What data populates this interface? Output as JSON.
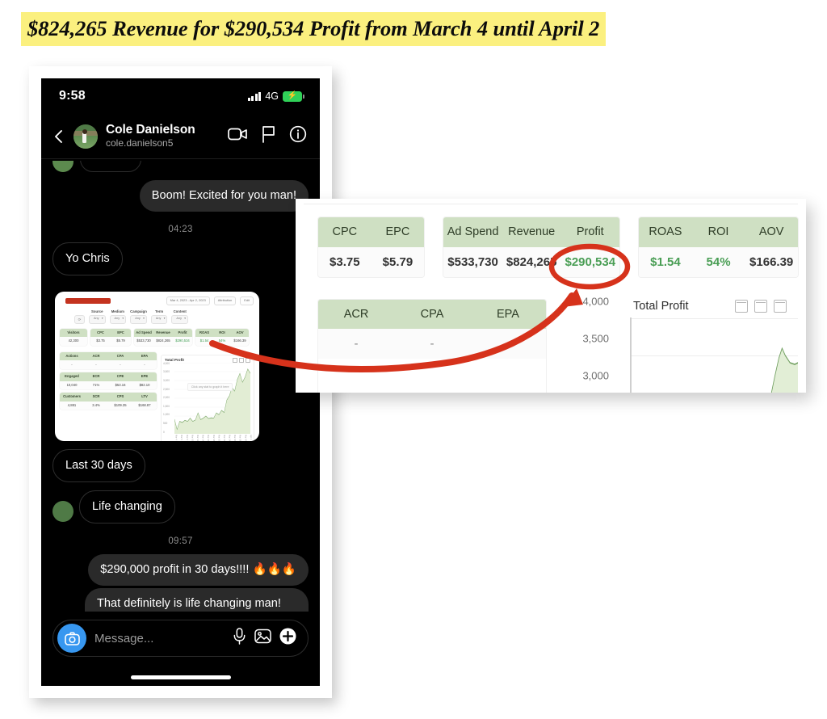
{
  "headline": "$824,265 Revenue for $290,534 Profit from March 4 until April 2",
  "colors": {
    "highlight": "#fbf07f",
    "annotation_red": "#d6321b",
    "table_header_green": "#cfe0c3",
    "positive_green": "#4a9e55",
    "messenger_blue": "#3797f0"
  },
  "phone": {
    "status_bar": {
      "time": "9:58",
      "network": "4G",
      "signal_icon": "signal-bars-icon",
      "battery_icon": "battery-charging-icon"
    },
    "chat_header": {
      "back_icon": "back-chevron-icon",
      "avatar_icon": "user-avatar",
      "name": "Cole Danielson",
      "handle": "cole.danielson5",
      "video_icon": "video-call-icon",
      "flag_icon": "flag-icon",
      "info_icon": "info-icon"
    },
    "messages": [
      {
        "id": "m1",
        "dir": "out",
        "text": "Boom! Excited for you man!"
      },
      {
        "id": "t1",
        "dir": "time",
        "text": "04:23"
      },
      {
        "id": "m2",
        "dir": "in",
        "text": "Yo Chris"
      },
      {
        "id": "m3",
        "dir": "in-image",
        "text": ""
      },
      {
        "id": "m4",
        "dir": "in",
        "text": "Last 30 days"
      },
      {
        "id": "m5",
        "dir": "in",
        "text": "Life changing"
      },
      {
        "id": "t2",
        "dir": "time",
        "text": "09:57"
      },
      {
        "id": "m6",
        "dir": "out",
        "text": "$290,000 profit in 30 days!!!! 🔥🔥🔥"
      },
      {
        "id": "m7",
        "dir": "out",
        "text": "That definitely is life changing man! Congratulations 👏"
      }
    ],
    "input_bar": {
      "camera_icon": "camera-icon",
      "placeholder": "Message...",
      "mic_icon": "microphone-icon",
      "gallery_icon": "image-gallery-icon",
      "plus_icon": "plus-icon"
    }
  },
  "dashboard_thumbnail": {
    "toolbar": {
      "redacted_icon": "redaction-bar",
      "date_range": "Mar 4, 2023 - Apr 2, 2023",
      "attribution": "Attribution",
      "edit": "Edit",
      "calendar_icon": "calendar-icon",
      "attribution_icon": "attribution-icon",
      "edit_icon": "pencil-icon"
    },
    "filters": [
      {
        "label": "Source",
        "value": "Any"
      },
      {
        "label": "Medium",
        "value": "Any"
      },
      {
        "label": "Campaign",
        "value": "Any"
      },
      {
        "label": "Term",
        "value": "Any"
      },
      {
        "label": "Content",
        "value": "Any"
      }
    ],
    "refresh_icon": "refresh-icon",
    "tables": [
      {
        "name": "visitors",
        "headers": [
          "Visitors"
        ],
        "values": [
          "42,300"
        ]
      },
      {
        "name": "cost",
        "headers": [
          "CPC",
          "EPC"
        ],
        "values": [
          "$3.75",
          "$5.79"
        ]
      },
      {
        "name": "revenue",
        "headers": [
          "Ad Spend",
          "Revenue",
          "Profit"
        ],
        "values": [
          "$533,730",
          "$824,265",
          "$290,534"
        ]
      },
      {
        "name": "returns",
        "headers": [
          "ROAS",
          "ROI",
          "AOV"
        ],
        "values": [
          "$1.54",
          "54%",
          "$166.39"
        ]
      },
      {
        "name": "actions",
        "headers": [
          "Actions",
          "ACR",
          "CPA",
          "EPA"
        ],
        "values": [
          "-",
          "-",
          "-",
          "-"
        ]
      },
      {
        "name": "engaged",
        "headers": [
          "Engaged",
          "ECR",
          "CPE",
          "EPE"
        ],
        "values": [
          "10,040",
          "71%",
          "$53.16",
          "$82.10"
        ]
      },
      {
        "name": "customers",
        "headers": [
          "Customers",
          "SCR",
          "CPS",
          "LTV"
        ],
        "values": [
          "4,881",
          "3.4%",
          "$109.35",
          "$168.87"
        ]
      }
    ],
    "chart": {
      "title": "Total Profit",
      "hint": "Click any stat to graph it here",
      "calendar_icons": [
        "calendar-month-icon",
        "calendar-week-icon",
        "calendar-day-icon"
      ]
    }
  },
  "zoom_panel": {
    "tables": [
      {
        "name": "cost",
        "headers": [
          "CPC",
          "EPC"
        ],
        "values": [
          "$3.75",
          "$5.79"
        ],
        "green": [
          false,
          false
        ]
      },
      {
        "name": "revenue",
        "headers": [
          "Ad Spend",
          "Revenue",
          "Profit"
        ],
        "values": [
          "$533,730",
          "$824,265",
          "$290,534"
        ],
        "green": [
          false,
          false,
          true
        ]
      },
      {
        "name": "returns",
        "headers": [
          "ROAS",
          "ROI",
          "AOV"
        ],
        "values": [
          "$1.54",
          "54%",
          "$166.39"
        ],
        "green": [
          true,
          true,
          false
        ]
      },
      {
        "name": "actions",
        "headers": [
          "ACR",
          "CPA",
          "EPA"
        ],
        "values": [
          "-",
          "-",
          "-"
        ],
        "green": [
          false,
          false,
          false
        ]
      }
    ],
    "chart": {
      "title": "Total Profit",
      "y_ticks": [
        "4,000",
        "3,500",
        "3,000"
      ],
      "calendar_icons": [
        "calendar-month-icon",
        "calendar-week-icon",
        "calendar-day-icon"
      ]
    },
    "annotation": {
      "circled_value": "$290,534",
      "shape": "red-ellipse-and-arrow"
    }
  },
  "chart_data": {
    "type": "area",
    "title": "Total Profit",
    "xlabel": "",
    "ylabel": "",
    "ylim": [
      0,
      4000
    ],
    "y_ticks": [
      0,
      500,
      1000,
      1500,
      2000,
      2500,
      3000,
      3500,
      4000
    ],
    "grid": true,
    "legend": "none",
    "categories": [
      "Mar 4",
      "Mar 5",
      "Mar 6",
      "Mar 7",
      "Mar 8",
      "Mar 9",
      "Mar 10",
      "Mar 11",
      "Mar 12",
      "Mar 13",
      "Mar 14",
      "Mar 15",
      "Mar 16",
      "Mar 17",
      "Mar 18",
      "Mar 19",
      "Mar 20",
      "Mar 21",
      "Mar 22",
      "Mar 23",
      "Mar 24",
      "Mar 25",
      "Mar 26",
      "Mar 27",
      "Mar 28",
      "Mar 29",
      "Mar 30",
      "Mar 31",
      "Apr 1",
      "Apr 2"
    ],
    "values": [
      820,
      250,
      700,
      640,
      760,
      700,
      880,
      700,
      780,
      1180,
      800,
      880,
      1000,
      860,
      900,
      880,
      1180,
      1080,
      1320,
      1200,
      1900,
      2150,
      2600,
      2400,
      3050,
      3400,
      2900,
      3200,
      3650,
      3400
    ]
  }
}
